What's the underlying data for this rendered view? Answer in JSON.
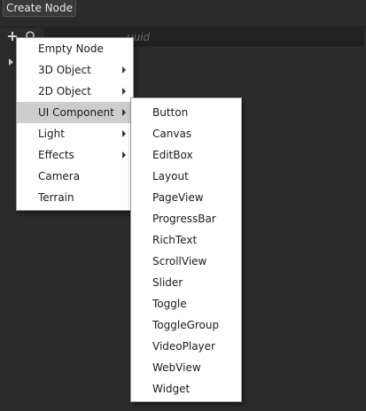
{
  "tooltip": {
    "label": "Create Node"
  },
  "toolbar": {
    "add_icon": "plus-icon",
    "search_icon": "search-icon",
    "search_placeholder_visible": "uuid"
  },
  "menu": {
    "items": [
      {
        "label": "Empty Node"
      },
      {
        "label": "3D Object",
        "has_submenu": true
      },
      {
        "label": "2D Object",
        "has_submenu": true
      },
      {
        "label": "UI Component",
        "has_submenu": true,
        "active": true
      },
      {
        "label": "Light",
        "has_submenu": true
      },
      {
        "label": "Effects",
        "has_submenu": true
      },
      {
        "label": "Camera"
      },
      {
        "label": "Terrain"
      }
    ]
  },
  "submenu": {
    "items": [
      {
        "label": "Button"
      },
      {
        "label": "Canvas"
      },
      {
        "label": "EditBox"
      },
      {
        "label": "Layout"
      },
      {
        "label": "PageView"
      },
      {
        "label": "ProgressBar"
      },
      {
        "label": "RichText"
      },
      {
        "label": "ScrollView"
      },
      {
        "label": "Slider"
      },
      {
        "label": "Toggle"
      },
      {
        "label": "ToggleGroup"
      },
      {
        "label": "VideoPlayer"
      },
      {
        "label": "WebView"
      },
      {
        "label": "Widget"
      }
    ]
  },
  "colors": {
    "background": "#2b2b2b",
    "menu_bg": "#ffffff",
    "menu_active": "#cdcdcd",
    "text": "#1a1a1a"
  }
}
